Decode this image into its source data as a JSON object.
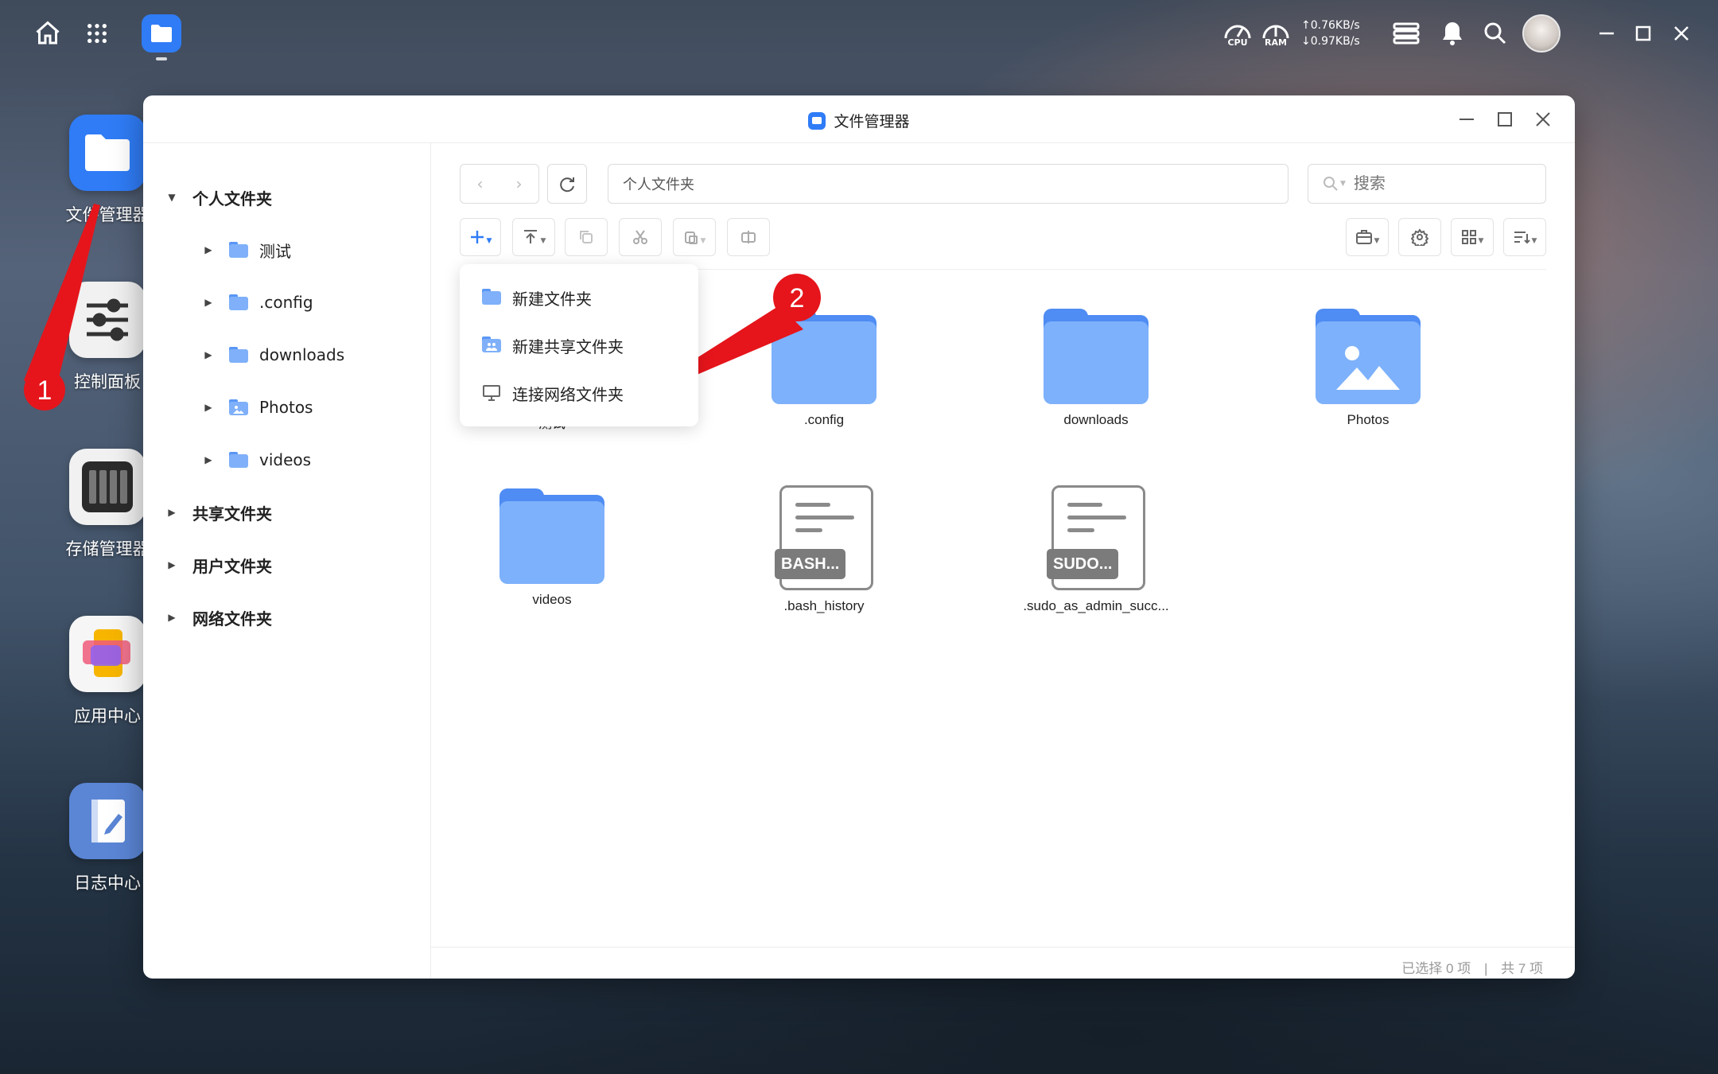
{
  "topbar": {
    "meters": [
      {
        "label": "CPU"
      },
      {
        "label": "RAM"
      }
    ],
    "net_up": "↑0.76KB/s",
    "net_down": "↓0.97KB/s"
  },
  "desktop": {
    "apps": [
      {
        "label": "文件管理器"
      },
      {
        "label": "控制面板"
      },
      {
        "label": "存储管理器"
      },
      {
        "label": "应用中心"
      },
      {
        "label": "日志中心"
      }
    ]
  },
  "window": {
    "title": "文件管理器",
    "path": "个人文件夹",
    "search_placeholder": "搜索"
  },
  "sidebar": {
    "personal": "个人文件夹",
    "children": [
      "测试",
      ".config",
      "downloads",
      "Photos",
      "videos"
    ],
    "shared": "共享文件夹",
    "users": "用户文件夹",
    "network": "网络文件夹"
  },
  "menu": {
    "items": [
      "新建文件夹",
      "新建共享文件夹",
      "连接网络文件夹"
    ]
  },
  "files": [
    {
      "name": "测试",
      "kind": "folder"
    },
    {
      "name": ".config",
      "kind": "folder"
    },
    {
      "name": "downloads",
      "kind": "folder"
    },
    {
      "name": "Photos",
      "kind": "photos-folder"
    },
    {
      "name": "videos",
      "kind": "folder"
    },
    {
      "name": ".bash_history",
      "kind": "doc",
      "tag": "BASH..."
    },
    {
      "name": ".sudo_as_admin_succ...",
      "kind": "doc",
      "tag": "SUDO..."
    }
  ],
  "status": {
    "selected": "已选择 0 项",
    "divider": "|",
    "total": "共 7 项"
  },
  "annotations": {
    "marker1": "1",
    "marker2": "2",
    "color": "#e5151b"
  }
}
